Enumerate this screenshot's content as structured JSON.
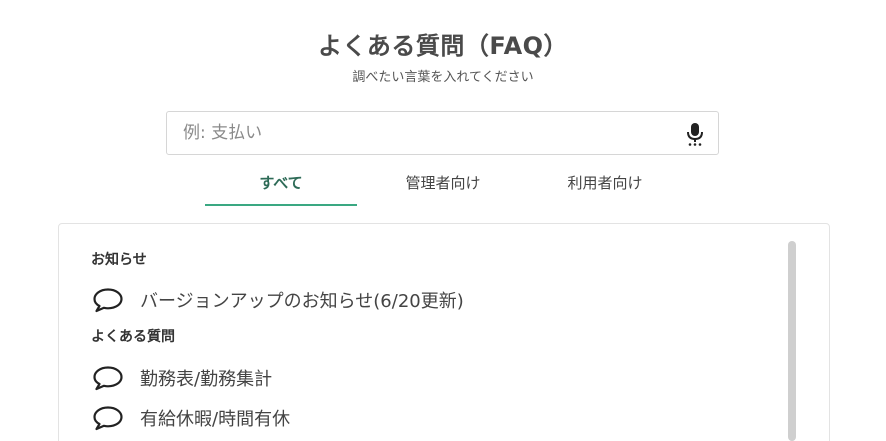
{
  "header": {
    "title": "よくある質問（FAQ）",
    "subtitle": "調べたい言葉を入れてください"
  },
  "search": {
    "placeholder": "例: 支払い",
    "value": "",
    "mic_icon": "microphone-icon"
  },
  "tabs": [
    {
      "label": "すべて",
      "active": true
    },
    {
      "label": "管理者向け",
      "active": false
    },
    {
      "label": "利用者向け",
      "active": false
    }
  ],
  "colors": {
    "accent": "#3aa882",
    "active_tab_text": "#2e6b57"
  },
  "sections": [
    {
      "heading": "お知らせ",
      "items": [
        {
          "icon": "speech-bubble-icon",
          "label": "バージョンアップのお知らせ(6/20更新)"
        }
      ]
    },
    {
      "heading": "よくある質問",
      "items": [
        {
          "icon": "speech-bubble-icon",
          "label": "勤務表/勤務集計"
        },
        {
          "icon": "speech-bubble-icon",
          "label": "有給休暇/時間有休"
        }
      ]
    }
  ]
}
